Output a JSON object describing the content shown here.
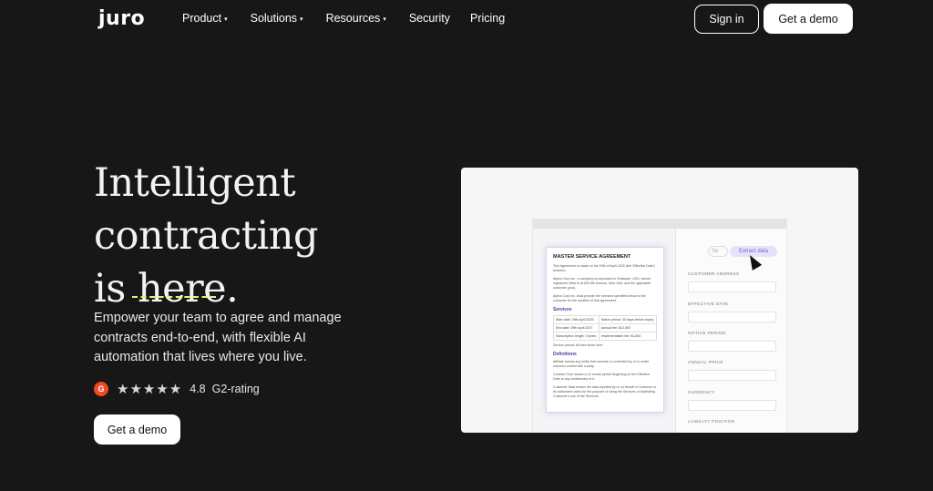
{
  "nav": {
    "logo": "juro",
    "items": [
      {
        "label": "Product",
        "caret": "▾"
      },
      {
        "label": "Solutions",
        "caret": "▾"
      },
      {
        "label": "Resources",
        "caret": "▾"
      },
      {
        "label": "Security",
        "caret": ""
      },
      {
        "label": "Pricing",
        "caret": ""
      }
    ],
    "signin_label": "Sign in",
    "demo_label": "Get a demo"
  },
  "hero": {
    "title_lines": [
      "Intelligent",
      "contracting",
      "is here."
    ],
    "subtitle": "Empower your team to agree and manage contracts end-to-end, with flexible AI automation that lives where you live.",
    "rating": {
      "badge": "G",
      "stars": "★★★★★",
      "score": "4.8",
      "label": "G2-rating"
    },
    "cta_label": "Get a demo"
  },
  "product": {
    "doc": {
      "title": "MASTER SERVICE AGREEMENT",
      "intro": "This Agreement is made on the 29th of April 2025 (the 'Effective Date') between",
      "party1": "Alpha Corp Inc., a company incorporated in Delaware, USA, whose registered office is at 620 8th Avenue, New York, and the applicable customer (you).",
      "party2": "Alpha Corp Inc. shall provide the services specified below to the customer for the duration of this agreement.",
      "services_heading": "Services",
      "services_rows": [
        [
          "Start date: 29th April 2025",
          "Notice period: 30 days before expiry"
        ],
        [
          "End date: 29th April 2027",
          "Annual fee: $12,500"
        ],
        [
          "Subscription length: 2 years",
          "Implementation fee: $1,800"
        ]
      ],
      "services_note": "Service period: All fees show here.",
      "definitions_heading": "Definitions",
      "def1": "Affiliate means any entity that controls, is controlled by, or is under common control with a party.",
      "def2": "Contract Year means a 12-month period beginning on the Effective Date or any anniversary of it.",
      "def3": "Customer Data means the data inputted by or on behalf of Customer or its authorized users for the purpose of using the Services or facilitating Customer's use of the Services."
    },
    "search_placeholder": "Se",
    "extract_label": "Extract data",
    "fields": [
      "CUSTOMER ADDRESS",
      "EFFECTIVE DATE",
      "NOTICE PERIOD",
      "ANNUAL PRICE",
      "CURRENCY",
      "LIABILITY POSITION"
    ]
  },
  "colors": {
    "background": "#171717",
    "accent_underline": "#e6f26a",
    "g2_badge": "#ef4a25",
    "extract_button": "#e7e1fb"
  }
}
